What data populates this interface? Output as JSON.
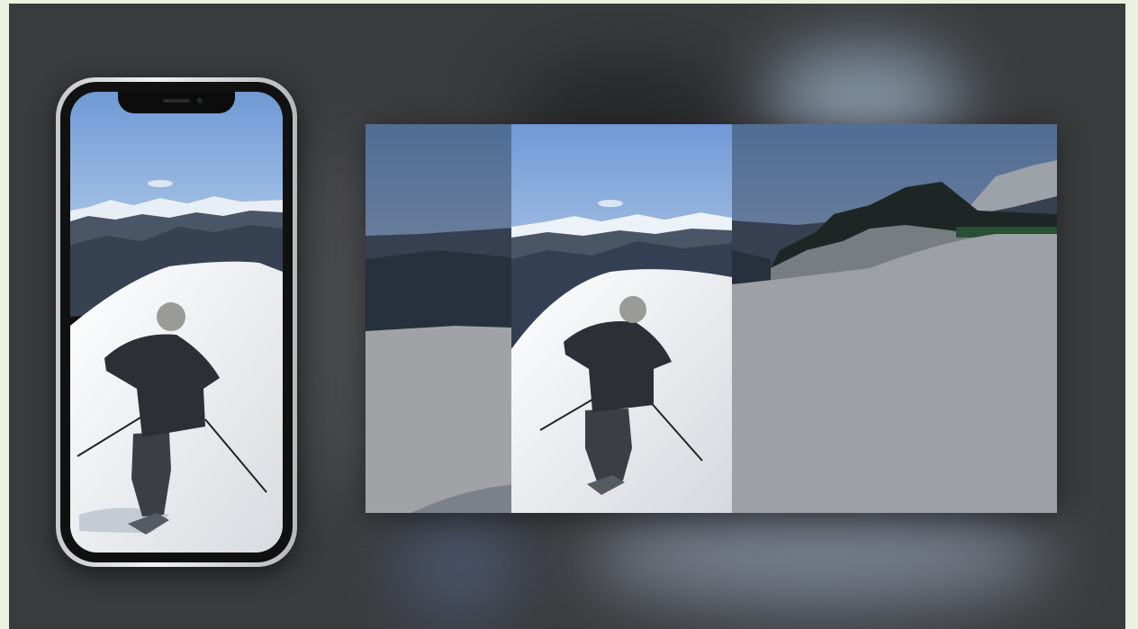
{
  "scene": {
    "description_items": [
      "phone-preview",
      "stabilized-video-comparison"
    ],
    "colors": {
      "backdrop": "#3a3b3d",
      "page_edge": "#ecf1e0",
      "sky": "#7ea3d6",
      "snow": "#f2f3f5",
      "skier_jacket": "#2c2f36"
    },
    "phone": {
      "icon": "smartphone-icon"
    },
    "video": {
      "segments": [
        "left-cropped-region",
        "center-frame",
        "right-cropped-region"
      ]
    }
  }
}
